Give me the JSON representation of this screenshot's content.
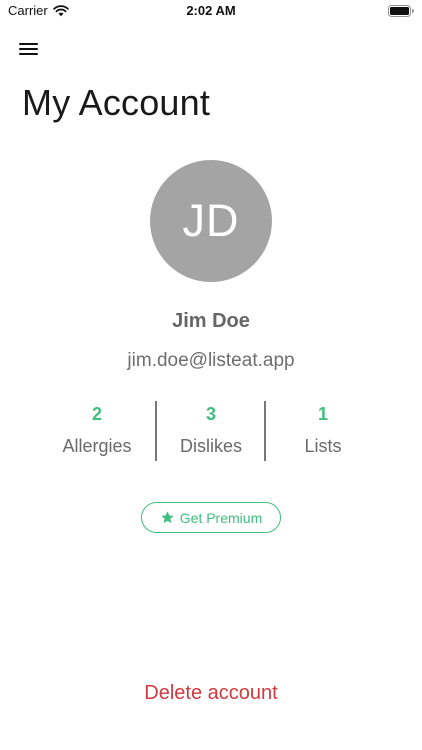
{
  "status_bar": {
    "carrier": "Carrier",
    "time": "2:02 AM",
    "icons": [
      "wifi-icon",
      "battery-icon"
    ]
  },
  "header": {
    "menu_icon": "hamburger-menu-icon",
    "title": "My Account"
  },
  "profile": {
    "initials": "JD",
    "name": "Jim Doe",
    "email": "jim.doe@listeat.app",
    "avatar_color": "#a4a4a4"
  },
  "stats": [
    {
      "value": "2",
      "label": "Allergies"
    },
    {
      "value": "3",
      "label": "Dislikes"
    },
    {
      "value": "1",
      "label": "Lists"
    }
  ],
  "premium": {
    "label": "Get Premium",
    "icon": "star-icon"
  },
  "footer": {
    "delete_label": "Delete account"
  },
  "colors": {
    "accent": "#3fbf7f",
    "danger": "#cf3a3f",
    "text_muted": "#6a6a6a"
  }
}
